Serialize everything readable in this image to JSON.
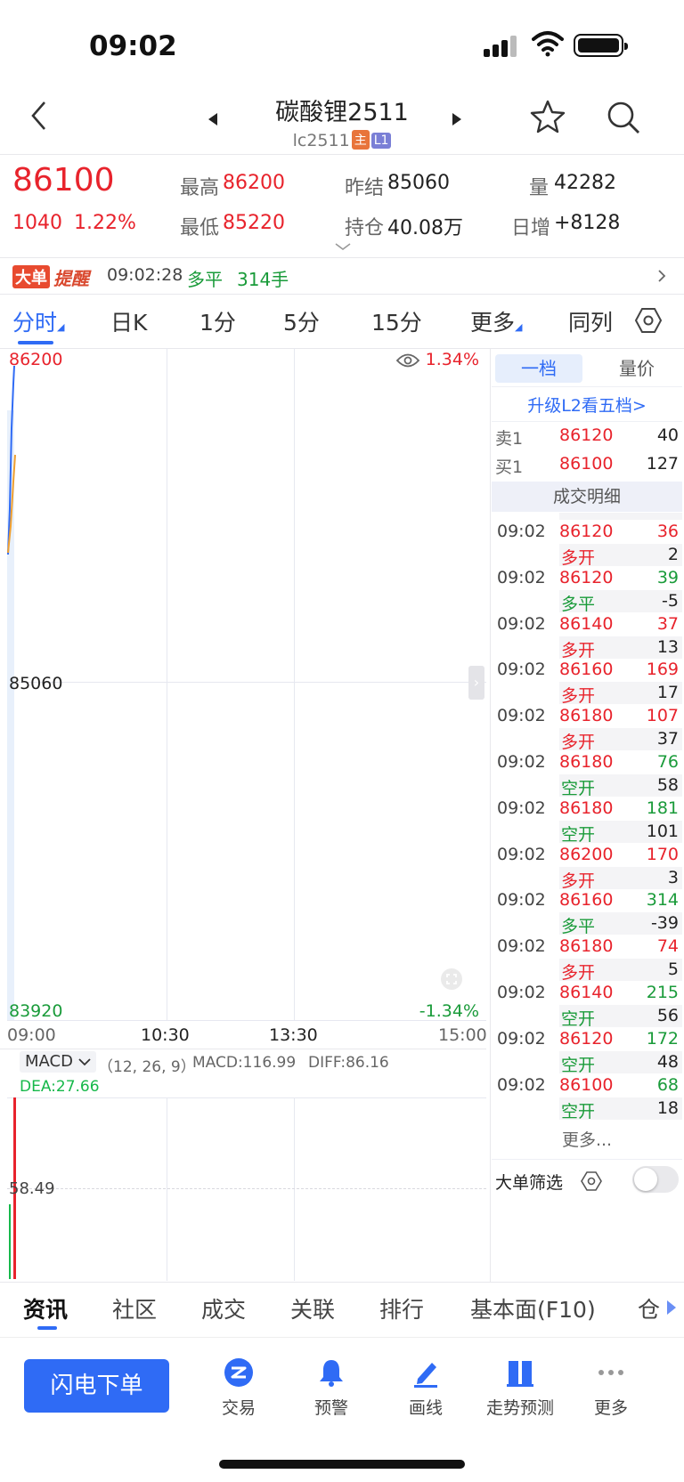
{
  "status": {
    "time": "09:02"
  },
  "header": {
    "title": "碳酸锂2511",
    "code": "lc2511",
    "tag_main": "主",
    "tag_level": "L1"
  },
  "quote": {
    "last": "86100",
    "change": "1040",
    "change_pct": "1.22%",
    "high_label": "最高",
    "high": "86200",
    "low_label": "最低",
    "low": "85220",
    "prev_settle_label": "昨结",
    "prev_settle": "85060",
    "oi_label": "持仓",
    "oi": "40.08万",
    "volume_label": "量",
    "volume": "42282",
    "daily_inc_label": "日增",
    "daily_inc": "+8128"
  },
  "alert": {
    "badge_a": "大单",
    "badge_b": "提醒",
    "time": "09:02:28",
    "type": "多平",
    "qty": "314手"
  },
  "tabs": [
    "分时",
    "日K",
    "1分",
    "5分",
    "15分",
    "更多",
    "同列"
  ],
  "chart": {
    "price_top": "86200",
    "price_mid": "85060",
    "price_bottom": "83920",
    "pct_top": "1.34%",
    "pct_bottom": "-1.34%",
    "times": [
      "09:00",
      "10:30",
      "13:30",
      "15:00"
    ],
    "indicator": "MACD",
    "params": "（12, 26, 9）",
    "macd": "MACD:116.99",
    "diff": "DIFF:86.16",
    "dea": "DEA:27.66",
    "macd_level": "58.49"
  },
  "book": {
    "tab_active": "一档",
    "tab_other": "量价",
    "upgrade": "升级L2看五档>",
    "ask_label": "卖1",
    "ask_price": "86120",
    "ask_qty": "40",
    "bid_label": "买1",
    "bid_price": "86100",
    "bid_qty": "127",
    "detail_title": "成交明细",
    "more": "更多...",
    "filter_label": "大单筛选",
    "trades": [
      {
        "time": "09:02",
        "price": "86120",
        "qty": "36",
        "type": "多开",
        "oi": "2",
        "qcolor": "red"
      },
      {
        "time": "09:02",
        "price": "86120",
        "qty": "39",
        "type": "多平",
        "oi": "-5",
        "qcolor": "green"
      },
      {
        "time": "09:02",
        "price": "86140",
        "qty": "37",
        "type": "多开",
        "oi": "13",
        "qcolor": "red"
      },
      {
        "time": "09:02",
        "price": "86160",
        "qty": "169",
        "type": "多开",
        "oi": "17",
        "qcolor": "red"
      },
      {
        "time": "09:02",
        "price": "86180",
        "qty": "107",
        "type": "多开",
        "oi": "37",
        "qcolor": "red"
      },
      {
        "time": "09:02",
        "price": "86180",
        "qty": "76",
        "type": "空开",
        "oi": "58",
        "qcolor": "green"
      },
      {
        "time": "09:02",
        "price": "86180",
        "qty": "181",
        "type": "空开",
        "oi": "101",
        "qcolor": "green"
      },
      {
        "time": "09:02",
        "price": "86200",
        "qty": "170",
        "type": "多开",
        "oi": "3",
        "qcolor": "red"
      },
      {
        "time": "09:02",
        "price": "86160",
        "qty": "314",
        "type": "多平",
        "oi": "-39",
        "qcolor": "green"
      },
      {
        "time": "09:02",
        "price": "86180",
        "qty": "74",
        "type": "多开",
        "oi": "5",
        "qcolor": "red"
      },
      {
        "time": "09:02",
        "price": "86140",
        "qty": "215",
        "type": "空开",
        "oi": "56",
        "qcolor": "green"
      },
      {
        "time": "09:02",
        "price": "86120",
        "qty": "172",
        "type": "空开",
        "oi": "48",
        "qcolor": "green"
      },
      {
        "time": "09:02",
        "price": "86100",
        "qty": "68",
        "type": "空开",
        "oi": "18",
        "qcolor": "green"
      }
    ]
  },
  "bottom_tabs": [
    "资讯",
    "社区",
    "成交",
    "关联",
    "排行",
    "基本面(F10)",
    "仓"
  ],
  "toolbar": {
    "flash_order": "闪电下单",
    "items": [
      "交易",
      "预警",
      "画线",
      "走势预测",
      "更多"
    ]
  },
  "colors": {
    "up": "#e8232c",
    "down": "#1a9b3a",
    "accent": "#2f6bf5"
  }
}
